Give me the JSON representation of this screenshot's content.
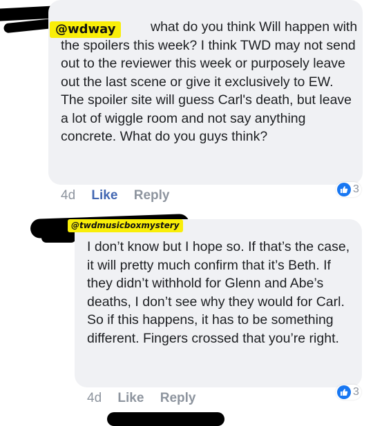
{
  "comment1": {
    "tag": "@wdway",
    "text": "what do you think Will happen with the spoilers this week? I think TWD may not send out to the reviewer this week or purposely leave out the last scene or give it exclusively to EW. The spoiler site will guess Carl's death, but leave a lot of wiggle room and not say anything concrete. What do you guys think?",
    "time": "4d",
    "like_label": "Like",
    "reply_label": "Reply",
    "reaction_icon": "thumbs-up-icon",
    "reaction_count": "3"
  },
  "comment2": {
    "tag": "@twdmusicboxmystery",
    "text": "I don’t know but I hope so. If that’s the case, it will pretty much confirm that it’s Beth. If they didn’t withhold for Glenn and Abe’s deaths, I don’t see why they would for Carl. So if this happens, it has to be something different. Fingers crossed that you’re right.",
    "time": "4d",
    "like_label": "Like",
    "reply_label": "Reply",
    "reaction_icon": "thumbs-up-icon",
    "reaction_count": "3"
  },
  "colors": {
    "bubble": "#f0f1f4",
    "tag_highlight": "#f9ee08",
    "like_active": "#4267b2",
    "reaction_blue": "#1877f2"
  }
}
